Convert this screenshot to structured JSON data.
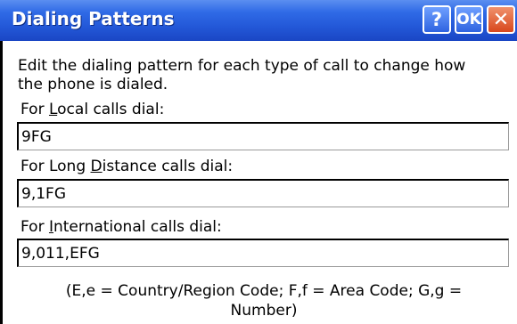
{
  "window": {
    "title": "Dialing Patterns",
    "help_label": "?",
    "ok_label": "OK",
    "close_label": "✕"
  },
  "instructions": {
    "line1": "Edit the dialing pattern for each type of call to change how",
    "line2": "the phone is dialed."
  },
  "local": {
    "label_pre": "For ",
    "label_key": "L",
    "label_post": "ocal calls dial:",
    "value": "9FG"
  },
  "long_distance": {
    "label_pre": "For Long ",
    "label_key": "D",
    "label_post": "istance calls dial:",
    "value": "9,1FG"
  },
  "international": {
    "label_pre": "For ",
    "label_key": "I",
    "label_post": "nternational calls dial:",
    "value": "9,011,EFG"
  },
  "legend": {
    "line1": "(E,e = Country/Region Code; F,f = Area Code; G,g =",
    "line2": "Number)"
  },
  "colors": {
    "titlebar": "#2358d8",
    "close_button": "#d8471c",
    "background": "#ffffff"
  }
}
